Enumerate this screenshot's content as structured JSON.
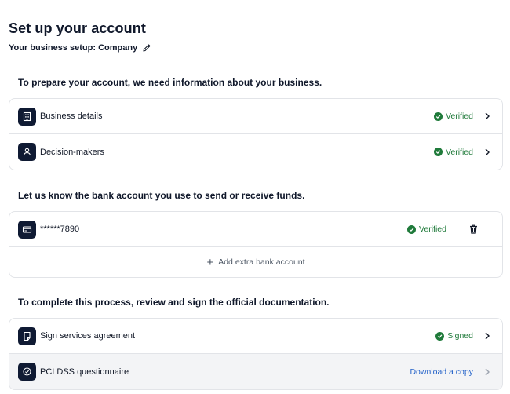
{
  "header": {
    "title": "Set up your account",
    "setup_label": "Your business setup: Company"
  },
  "sections": {
    "business": {
      "heading": "To prepare your account, we need information about your business.",
      "rows": [
        {
          "label": "Business details",
          "icon": "building-icon",
          "status": "Verified"
        },
        {
          "label": "Decision-makers",
          "icon": "person-icon",
          "status": "Verified"
        }
      ]
    },
    "bank": {
      "heading": "Let us know the bank account you use to send or receive funds.",
      "account": {
        "label": "******7890",
        "icon": "bank-card-icon",
        "status": "Verified"
      },
      "add_label": "Add extra bank account"
    },
    "docs": {
      "heading": "To complete this process, review and sign the official documentation.",
      "rows": [
        {
          "label": "Sign services agreement",
          "icon": "document-icon",
          "status": "Signed"
        },
        {
          "label": "PCI DSS questionnaire",
          "icon": "shield-check-icon",
          "link": "Download a copy"
        }
      ]
    }
  },
  "colors": {
    "success": "#1f7a3a",
    "link": "#2563c9",
    "icon_bg": "#0f1a33"
  }
}
